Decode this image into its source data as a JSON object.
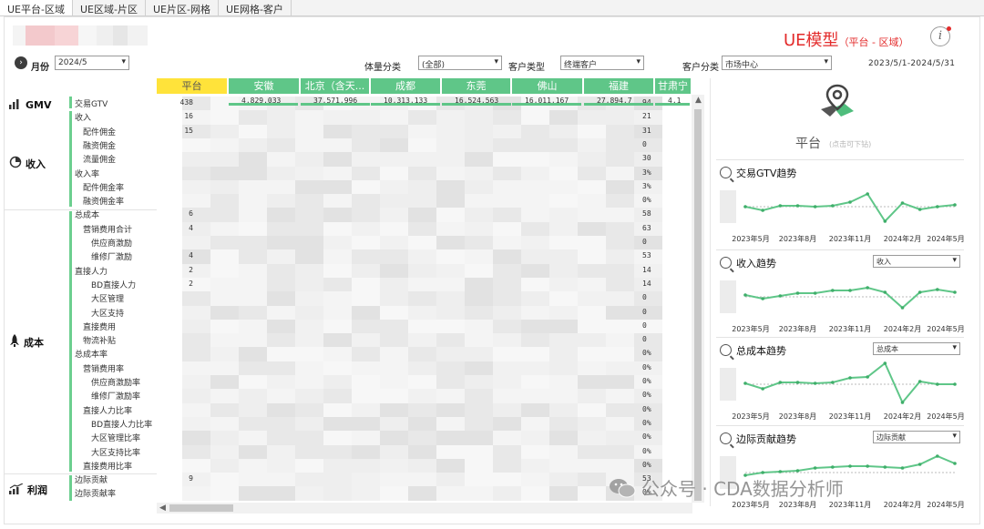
{
  "tabs": [
    {
      "label": "UE平台-区域",
      "active": true
    },
    {
      "label": "UE区域-片区",
      "active": false
    },
    {
      "label": "UE片区-网格",
      "active": false
    },
    {
      "label": "UE网格-客户",
      "active": false
    }
  ],
  "title": {
    "main": "UE模型",
    "sub": "（平台 - 区域）"
  },
  "filters": {
    "month_label": "月份",
    "month_value": "2024/5",
    "volume_label": "体量分类",
    "volume_value": "(全部)",
    "customer_type_label": "客户类型",
    "customer_type_value": "终端客户",
    "customer_class_label": "客户分类",
    "customer_class_value": "市场中心",
    "date_range": "2023/5/1-2024/5/31"
  },
  "categories": {
    "gmv": "GMV",
    "income": "收入",
    "cost": "成本",
    "profit": "利润"
  },
  "rows": [
    "交易GTV",
    "收入",
    "配件佣金",
    "融资佣金",
    "流量佣金",
    "收入率",
    "配件佣金率",
    "融资佣金率",
    "总成本",
    "营销费用合计",
    "供应商激励",
    "维修厂激励",
    "直接人力",
    "BD直接人力",
    "大区管理",
    "大区支持",
    "直接费用",
    "物流补贴",
    "总成本率",
    "营销费用率",
    "供应商激励率",
    "维修厂激励率",
    "直接人力比率",
    "BD直接人力比率",
    "大区管理比率",
    "大区支持比率",
    "直接费用比率",
    "边际贡献",
    "边际贡献率"
  ],
  "columns": [
    "平台",
    "安徽",
    "北京（含天...",
    "成都",
    "东莞",
    "佛山",
    "福建",
    "甘肃宁"
  ],
  "table": {
    "first_col_partial": [
      "438",
      "16",
      "15",
      "",
      "",
      "",
      "",
      "",
      "6",
      "4",
      "",
      "4",
      "2",
      "2",
      "",
      "",
      "",
      "",
      "",
      "",
      "",
      "",
      "",
      "",
      "",
      "",
      "",
      "9",
      ""
    ],
    "header_row_partial": [
      "4,829,033",
      "37,571,996",
      "10,313,133",
      "16,524,563",
      "16,011,167",
      "27,894,7",
      "4,1"
    ],
    "last_col_partial": [
      "94",
      "21",
      "31",
      "0",
      "30",
      "3%",
      "3%",
      "0%",
      "58",
      "63",
      "0",
      "53",
      "14",
      "14",
      "0",
      "0",
      "0",
      "0",
      "0%",
      "0%",
      "0%",
      "0%",
      "0%",
      "0%",
      "0%",
      "0%",
      "0%",
      "53",
      "0%"
    ]
  },
  "right_panel": {
    "title": "平台",
    "hint": "(点击可下钻)",
    "trends": [
      {
        "title": "交易GTV趋势",
        "select": null
      },
      {
        "title": "收入趋势",
        "select": "收入"
      },
      {
        "title": "总成本趋势",
        "select": "总成本"
      },
      {
        "title": "边际贡献趋势",
        "select": "边际贡献"
      }
    ],
    "x_ticks": [
      "2023年5月",
      "2023年8月",
      "2023年11月",
      "2024年2月",
      "2024年5月"
    ]
  },
  "chart_data": [
    {
      "type": "line",
      "title": "交易GTV趋势",
      "x": [
        "2023/5",
        "2023/6",
        "2023/7",
        "2023/8",
        "2023/9",
        "2023/10",
        "2023/11",
        "2023/12",
        "2024/1",
        "2024/2",
        "2024/3",
        "2024/4",
        "2024/5"
      ],
      "series": [
        {
          "values": [
            0.0,
            -0.4,
            0.1,
            0.1,
            0.0,
            0.1,
            0.5,
            1.4,
            -1.6,
            0.4,
            -0.3,
            0.0,
            0.2
          ]
        }
      ]
    },
    {
      "type": "line",
      "title": "收入趋势",
      "x": [
        "2023/5",
        "2023/6",
        "2023/7",
        "2023/8",
        "2023/9",
        "2023/10",
        "2023/11",
        "2023/12",
        "2024/1",
        "2024/2",
        "2024/3",
        "2024/4",
        "2024/5"
      ],
      "series": [
        {
          "values": [
            0.2,
            -0.2,
            0.1,
            0.4,
            0.4,
            0.7,
            0.7,
            1.0,
            0.5,
            -1.2,
            0.5,
            0.8,
            0.5
          ]
        }
      ]
    },
    {
      "type": "line",
      "title": "总成本趋势",
      "x": [
        "2023/5",
        "2023/6",
        "2023/7",
        "2023/8",
        "2023/9",
        "2023/10",
        "2023/11",
        "2023/12",
        "2024/1",
        "2024/2",
        "2024/3",
        "2024/4",
        "2024/5"
      ],
      "series": [
        {
          "values": [
            0.1,
            -0.5,
            0.2,
            0.2,
            0.1,
            0.2,
            0.7,
            0.8,
            2.3,
            -2.0,
            0.3,
            0.0,
            0.0
          ]
        }
      ]
    },
    {
      "type": "line",
      "title": "边际贡献趋势",
      "x": [
        "2023/5",
        "2023/6",
        "2023/7",
        "2023/8",
        "2023/9",
        "2023/10",
        "2023/11",
        "2023/12",
        "2024/1",
        "2024/2",
        "2024/3",
        "2024/4",
        "2024/5"
      ],
      "series": [
        {
          "values": [
            -0.3,
            0.0,
            0.1,
            0.2,
            0.5,
            0.6,
            0.7,
            0.7,
            0.6,
            0.5,
            0.9,
            1.8,
            1.0
          ]
        }
      ]
    }
  ],
  "watermark": "公众号 · CDA数据分析师",
  "colors": {
    "accent_green": "#5fc688",
    "highlight_yellow": "#ffe33a",
    "title_red": "#e32b2b"
  }
}
